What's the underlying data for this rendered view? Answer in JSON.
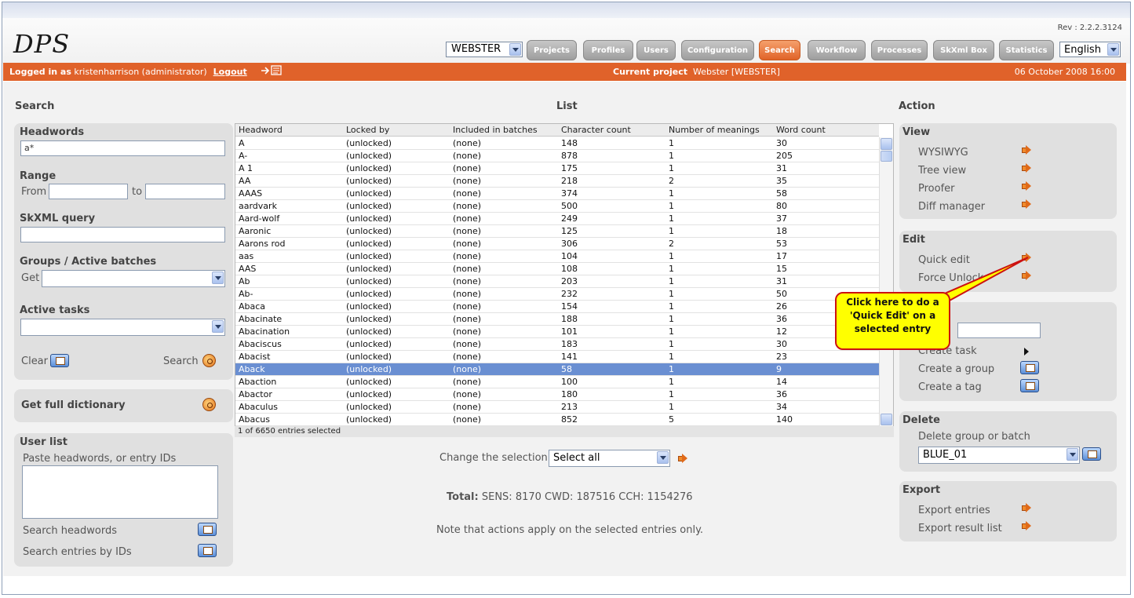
{
  "app": {
    "logo": "DPS",
    "revision": "Rev : 2.2.2.3124",
    "project_select": "WEBSTER",
    "language": "English",
    "nav": [
      "Projects",
      "Profiles",
      "Users",
      "Configuration",
      "Search",
      "Workflow",
      "Processes",
      "SkXml Box",
      "Statistics"
    ],
    "active_nav": "Search"
  },
  "statusbar": {
    "logged_in_label": "Logged in as",
    "user": "kristenharrison (administrator)",
    "logout": "Logout",
    "current_project_label": "Current project",
    "current_project": "Webster [WEBSTER]",
    "datetime": "06 October 2008 16:00"
  },
  "search": {
    "title": "Search",
    "headwords_label": "Headwords",
    "headwords_value": "a*",
    "range_label": "Range",
    "from_label": "From",
    "to_label": "to",
    "skxml_label": "SkXML query",
    "groups_label": "Groups / Active batches",
    "get_label": "Get",
    "active_tasks_label": "Active tasks",
    "clear_label": "Clear",
    "search_label": "Search",
    "full_dict_label": "Get full dictionary",
    "userlist_label": "User list",
    "paste_label": "Paste headwords, or entry IDs",
    "search_headwords": "Search headwords",
    "search_ids": "Search entries by IDs"
  },
  "list": {
    "title": "List",
    "columns": [
      "Headword",
      "Locked by",
      "Included in batches",
      "Character count",
      "Number of meanings",
      "Word count"
    ],
    "rows": [
      [
        "A",
        "(unlocked)",
        "(none)",
        "148",
        "1",
        "30"
      ],
      [
        "A-",
        "(unlocked)",
        "(none)",
        "878",
        "1",
        "205"
      ],
      [
        "A 1",
        "(unlocked)",
        "(none)",
        "175",
        "1",
        "31"
      ],
      [
        "AA",
        "(unlocked)",
        "(none)",
        "218",
        "2",
        "35"
      ],
      [
        "AAAS",
        "(unlocked)",
        "(none)",
        "374",
        "1",
        "58"
      ],
      [
        "aardvark",
        "(unlocked)",
        "(none)",
        "500",
        "1",
        "80"
      ],
      [
        "Aard-wolf",
        "(unlocked)",
        "(none)",
        "249",
        "1",
        "37"
      ],
      [
        "Aaronic",
        "(unlocked)",
        "(none)",
        "125",
        "1",
        "18"
      ],
      [
        "Aarons rod",
        "(unlocked)",
        "(none)",
        "306",
        "2",
        "53"
      ],
      [
        "aas",
        "(unlocked)",
        "(none)",
        "104",
        "1",
        "17"
      ],
      [
        "AAS",
        "(unlocked)",
        "(none)",
        "108",
        "1",
        "15"
      ],
      [
        "Ab",
        "(unlocked)",
        "(none)",
        "203",
        "1",
        "31"
      ],
      [
        "Ab-",
        "(unlocked)",
        "(none)",
        "232",
        "1",
        "50"
      ],
      [
        "Abaca",
        "(unlocked)",
        "(none)",
        "154",
        "1",
        "26"
      ],
      [
        "Abacinate",
        "(unlocked)",
        "(none)",
        "188",
        "1",
        "36"
      ],
      [
        "Abacination",
        "(unlocked)",
        "(none)",
        "101",
        "1",
        "12"
      ],
      [
        "Abaciscus",
        "(unlocked)",
        "(none)",
        "183",
        "1",
        "30"
      ],
      [
        "Abacist",
        "(unlocked)",
        "(none)",
        "141",
        "1",
        "23"
      ],
      [
        "Aback",
        "(unlocked)",
        "(none)",
        "58",
        "1",
        "9"
      ],
      [
        "Abaction",
        "(unlocked)",
        "(none)",
        "100",
        "1",
        "14"
      ],
      [
        "Abactor",
        "(unlocked)",
        "(none)",
        "180",
        "1",
        "36"
      ],
      [
        "Abaculus",
        "(unlocked)",
        "(none)",
        "213",
        "1",
        "34"
      ],
      [
        "Abacus",
        "(unlocked)",
        "(none)",
        "852",
        "5",
        "140"
      ]
    ],
    "selected_index": 18,
    "footer": "1 of 6650 entries selected",
    "change_selection_label": "Change the selection",
    "change_selection_value": "Select all",
    "total_label": "Total:",
    "total_value": "SENS: 8170 CWD: 187516 CCH: 1154276",
    "note": "Note that actions apply on the selected entries only."
  },
  "action": {
    "title": "Action",
    "view_label": "View",
    "view_items": [
      "WYSIWYG",
      "Tree view",
      "Proofer",
      "Diff manager"
    ],
    "edit_label": "Edit",
    "edit_items": [
      "Quick edit",
      "Force Unlock"
    ],
    "create_task": "Create task",
    "create_group": "Create a group",
    "create_tag": "Create a tag",
    "delete_label": "Delete",
    "delete_sub": "Delete group or batch",
    "delete_select": "BLUE_01",
    "export_label": "Export",
    "export_items": [
      "Export entries",
      "Export result list"
    ]
  },
  "callout": {
    "text": "Click here to do a 'Quick Edit' on a selected entry",
    "color": "#ffff00",
    "border": "#cc1111"
  }
}
